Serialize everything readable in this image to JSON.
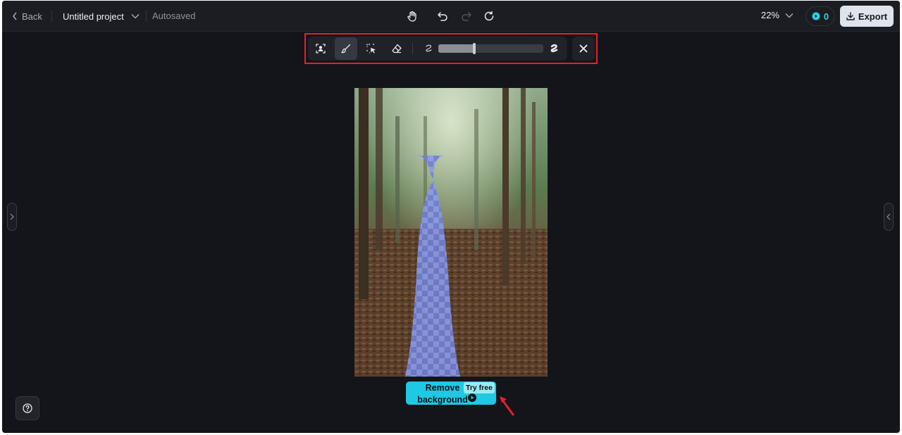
{
  "topbar": {
    "back_label": "Back",
    "project_name": "Untitled project",
    "autosave_status": "Autosaved",
    "zoom_level": "22%",
    "credits_count": "0",
    "export_label": "Export"
  },
  "toolbar": {
    "tools": [
      "auto-select-subject",
      "brush",
      "smart-select",
      "eraser"
    ],
    "active_tool": "brush",
    "brush_size_fraction": 0.34,
    "highlight_color": "#e5212c"
  },
  "canvas": {
    "image_description_icon": "photo-forest-person",
    "mask_color": "#7f8ee0"
  },
  "action": {
    "remove_bg_label": "Remove background",
    "try_free_badge": "Try free",
    "accent_color": "#1fc8e3"
  },
  "colors": {
    "background": "#14151a",
    "topbar": "#1b1d23",
    "export_bg": "#dfe4ec",
    "annotation_red": "#e5212c"
  }
}
